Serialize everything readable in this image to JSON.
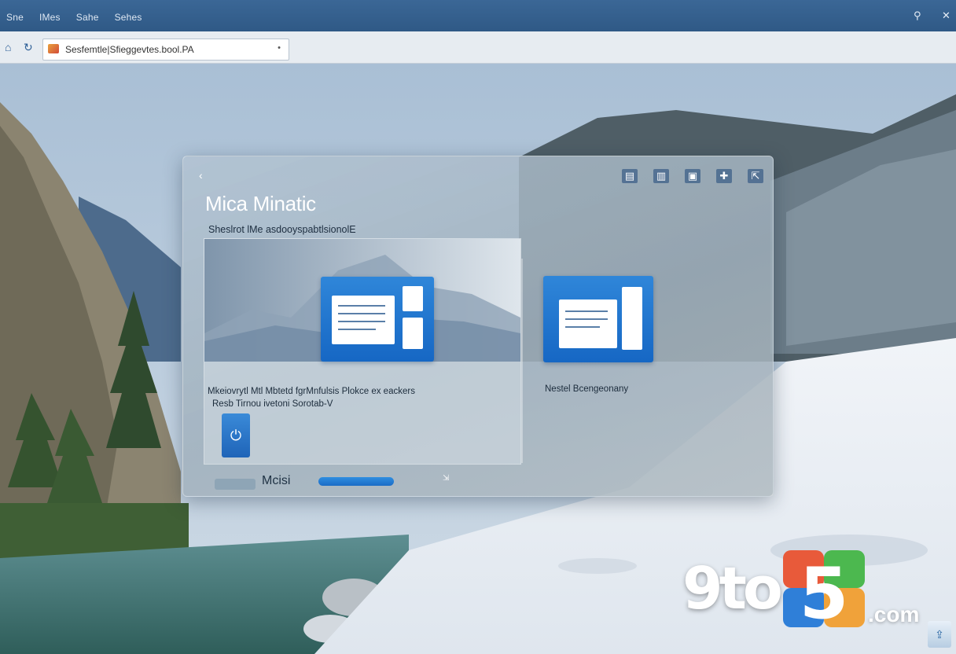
{
  "top_menu": [
    "Sne",
    "IMes",
    "Sahe",
    "Sehes"
  ],
  "top_icons": {
    "search": "search-icon",
    "close": "close-icon"
  },
  "address_bar": {
    "url": "Sesfemtle|Sfieggevtes.bool.PA",
    "back_icon": "home-icon",
    "refresh_icon": "refresh-icon"
  },
  "dialog": {
    "back_glyph": "‹",
    "title": "Mica Minatic",
    "subtitle": "Sheslrot lMe asdooyspabtlsionolE",
    "left_card": {
      "description_line1": "Mkeiovrytl Mtl Mbtetd fgrMnfulsis Plokce ex eackers",
      "description_line2": "Resb Tirnou ivetoni Sorotab-V"
    },
    "right_card": {
      "caption": "Nestel Bcengeonany"
    },
    "footer": {
      "label": "Mcisi",
      "progress": 1.0
    }
  },
  "watermark": {
    "brand": "9to5",
    "suffix": ".com"
  },
  "colors": {
    "accent": "#1f6fc8",
    "topbar": "#2f5986"
  }
}
